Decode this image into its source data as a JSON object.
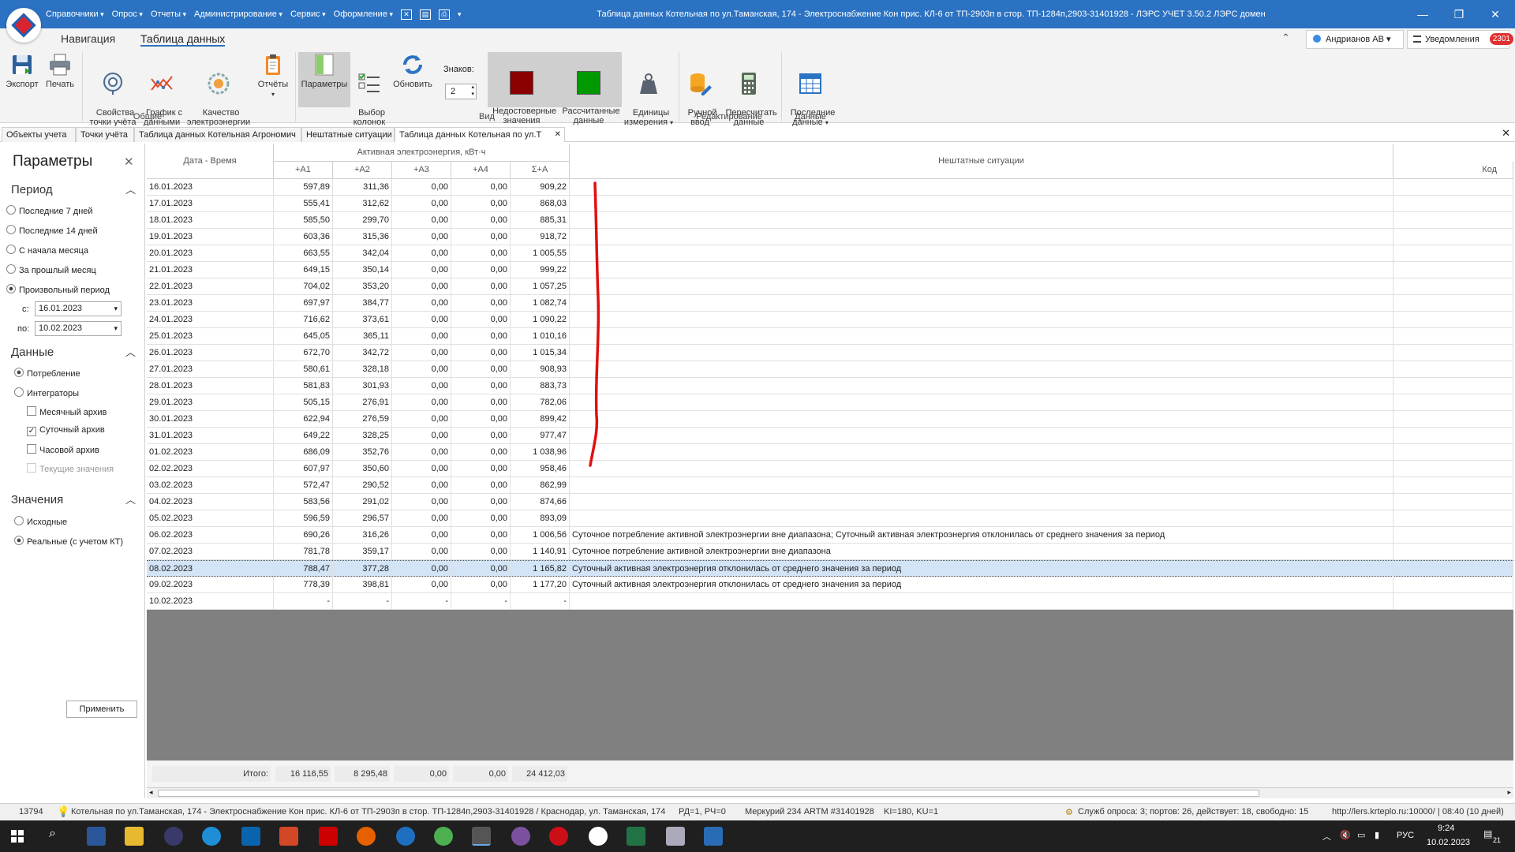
{
  "window": {
    "title": "Таблица данных Котельная по ул.Таманская, 174 - Электроснабжение Кон прис. КЛ-6 от ТП-2903п в стор. ТП-1284п,2903-31401928 - ЛЭРС УЧЕТ 3.50.2 ЛЭРС домен",
    "minimize": "—",
    "restore": "❐",
    "close": "✕"
  },
  "menu": [
    "Справочники",
    "Опрос",
    "Отчеты",
    "Администрирование",
    "Сервис",
    "Оформление"
  ],
  "ribbon": {
    "tabs": [
      "Навигация",
      "Таблица данных"
    ],
    "collapse": "⌃",
    "user": "Андрианов АВ ▾",
    "notifications": "Уведомления",
    "notif_count": "2301",
    "buttons": {
      "export": "Экспорт",
      "print": "Печать",
      "props": "Свойства\nточки учёта",
      "chart": "График с\nданными",
      "quality": "Качество\nэлектроэнергии",
      "reports": "Отчёты",
      "params": "Параметры",
      "columns": "Выбор\nколонок",
      "refresh": "Обновить",
      "invalid": "Недостоверные\nзначения",
      "calc": "Рассчитанные\nданные",
      "units": "Единицы\nизмерения",
      "manual": "Ручной\nввод",
      "recalc": "Пересчитать\nданные",
      "last": "Последние\nданные"
    },
    "znakov_label": "Знаков:",
    "znakov_value": "2",
    "groups": {
      "general": "Общие",
      "view": "Вид",
      "edit": "Редактирование",
      "data": "Данные"
    },
    "colors": {
      "invalid": "#8b0000",
      "calc": "#009900"
    }
  },
  "doc_tabs": [
    "Объекты учета",
    "Точки учёта",
    "Таблица данных Котельная Агрономич",
    "Нештатные ситуации",
    "Таблица данных Котельная по ул.Т"
  ],
  "doc_tab_close": "✕",
  "params": {
    "title": "Параметры",
    "close": "✕",
    "chevron": "︿",
    "period": {
      "title": "Период",
      "options": [
        "Последние 7 дней",
        "Последние 14 дней",
        "С начала месяца",
        "За прошлый месяц",
        "Произвольный период"
      ],
      "from_label": "с:",
      "from": "16.01.2023",
      "to_label": "по:",
      "to": "10.02.2023"
    },
    "data": {
      "title": "Данные",
      "options": [
        "Потребление",
        "Интеграторы"
      ],
      "archives": [
        "Месячный архив",
        "Суточный архив",
        "Часовой архив",
        "Текущие значения"
      ]
    },
    "values": {
      "title": "Значения",
      "options": [
        "Исходные",
        "Реальные (с учетом КТ)"
      ]
    },
    "apply": "Применить"
  },
  "table": {
    "headers": {
      "date": "Дата - Время",
      "group": "Активная электроэнергия, кВт·ч",
      "a1": "+A1",
      "a2": "+A2",
      "a3": "+A3",
      "a4": "+A4",
      "sum": "Σ+A",
      "events": "Нештатные ситуации",
      "code": "Код"
    },
    "rows": [
      [
        "16.01.2023",
        "597,89",
        "311,36",
        "0,00",
        "0,00",
        "909,22",
        ""
      ],
      [
        "17.01.2023",
        "555,41",
        "312,62",
        "0,00",
        "0,00",
        "868,03",
        ""
      ],
      [
        "18.01.2023",
        "585,50",
        "299,70",
        "0,00",
        "0,00",
        "885,31",
        ""
      ],
      [
        "19.01.2023",
        "603,36",
        "315,36",
        "0,00",
        "0,00",
        "918,72",
        ""
      ],
      [
        "20.01.2023",
        "663,55",
        "342,04",
        "0,00",
        "0,00",
        "1 005,55",
        ""
      ],
      [
        "21.01.2023",
        "649,15",
        "350,14",
        "0,00",
        "0,00",
        "999,22",
        ""
      ],
      [
        "22.01.2023",
        "704,02",
        "353,20",
        "0,00",
        "0,00",
        "1 057,25",
        ""
      ],
      [
        "23.01.2023",
        "697,97",
        "384,77",
        "0,00",
        "0,00",
        "1 082,74",
        ""
      ],
      [
        "24.01.2023",
        "716,62",
        "373,61",
        "0,00",
        "0,00",
        "1 090,22",
        ""
      ],
      [
        "25.01.2023",
        "645,05",
        "365,11",
        "0,00",
        "0,00",
        "1 010,16",
        ""
      ],
      [
        "26.01.2023",
        "672,70",
        "342,72",
        "0,00",
        "0,00",
        "1 015,34",
        ""
      ],
      [
        "27.01.2023",
        "580,61",
        "328,18",
        "0,00",
        "0,00",
        "908,93",
        ""
      ],
      [
        "28.01.2023",
        "581,83",
        "301,93",
        "0,00",
        "0,00",
        "883,73",
        ""
      ],
      [
        "29.01.2023",
        "505,15",
        "276,91",
        "0,00",
        "0,00",
        "782,06",
        ""
      ],
      [
        "30.01.2023",
        "622,94",
        "276,59",
        "0,00",
        "0,00",
        "899,42",
        ""
      ],
      [
        "31.01.2023",
        "649,22",
        "328,25",
        "0,00",
        "0,00",
        "977,47",
        ""
      ],
      [
        "01.02.2023",
        "686,09",
        "352,76",
        "0,00",
        "0,00",
        "1 038,96",
        ""
      ],
      [
        "02.02.2023",
        "607,97",
        "350,60",
        "0,00",
        "0,00",
        "958,46",
        ""
      ],
      [
        "03.02.2023",
        "572,47",
        "290,52",
        "0,00",
        "0,00",
        "862,99",
        ""
      ],
      [
        "04.02.2023",
        "583,56",
        "291,02",
        "0,00",
        "0,00",
        "874,66",
        ""
      ],
      [
        "05.02.2023",
        "596,59",
        "296,57",
        "0,00",
        "0,00",
        "893,09",
        ""
      ],
      [
        "06.02.2023",
        "690,26",
        "316,26",
        "0,00",
        "0,00",
        "1 006,56",
        "Суточное потребление активной электроэнергии вне диапазона; Суточный активная электроэнергия отклонилась от среднего значения за период"
      ],
      [
        "07.02.2023",
        "781,78",
        "359,17",
        "0,00",
        "0,00",
        "1 140,91",
        "Суточное потребление активной электроэнергии вне диапазона"
      ],
      [
        "08.02.2023",
        "788,47",
        "377,28",
        "0,00",
        "0,00",
        "1 165,82",
        "Суточный активная электроэнергия отклонилась от среднего значения за период"
      ],
      [
        "09.02.2023",
        "778,39",
        "398,81",
        "0,00",
        "0,00",
        "1 177,20",
        "Суточный активная электроэнергия отклонилась от среднего значения за период"
      ],
      [
        "10.02.2023",
        "-",
        "-",
        "-",
        "-",
        "-",
        ""
      ]
    ],
    "selected_row": 23,
    "totals": {
      "label": "Итого:",
      "a1": "16 116,55",
      "a2": "8 295,48",
      "a3": "0,00",
      "a4": "0,00",
      "sum": "24 412,03"
    }
  },
  "status": {
    "count": "13794",
    "object": "Котельная по ул.Таманская, 174 - Электроснабжение Кон прис. КЛ-6 от ТП-2903п в стор. ТП-1284п,2903-31401928 / Краснодар, ул. Таманская, 174",
    "rd": "РД=1, РЧ=0",
    "meter": "Меркурий 234 ARTM #31401928",
    "ki": "KI=180, KU=1",
    "services": "Служб опроса: 3; портов: 26, действует: 18, свободно: 15",
    "server": "http://lers.krteplo.ru:10000/ | 08:40 (10 дней)"
  },
  "taskbar": {
    "lang": "РУС",
    "time": "9:24",
    "date": "10.02.2023",
    "notif": "21"
  }
}
